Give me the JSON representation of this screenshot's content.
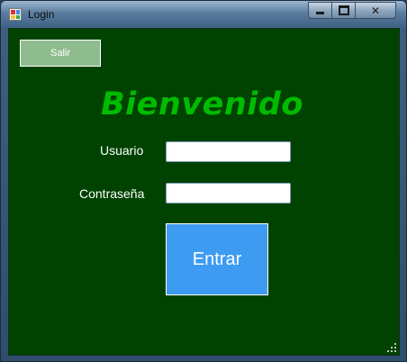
{
  "window": {
    "title": "Login",
    "controls": {
      "minimize_icon": "minimize-icon",
      "maximize_icon": "maximize-icon",
      "close_glyph": "✕"
    }
  },
  "form": {
    "exit_button": "Salir",
    "heading": "Bienvenido",
    "username_label": "Usuario",
    "username_value": "",
    "password_label": "Contraseña",
    "password_value": "",
    "submit_button": "Entrar"
  },
  "colors": {
    "background": "#004300",
    "heading": "#00bb00",
    "exit_button": "#8fbc8f",
    "submit_button": "#3d9bf2"
  }
}
